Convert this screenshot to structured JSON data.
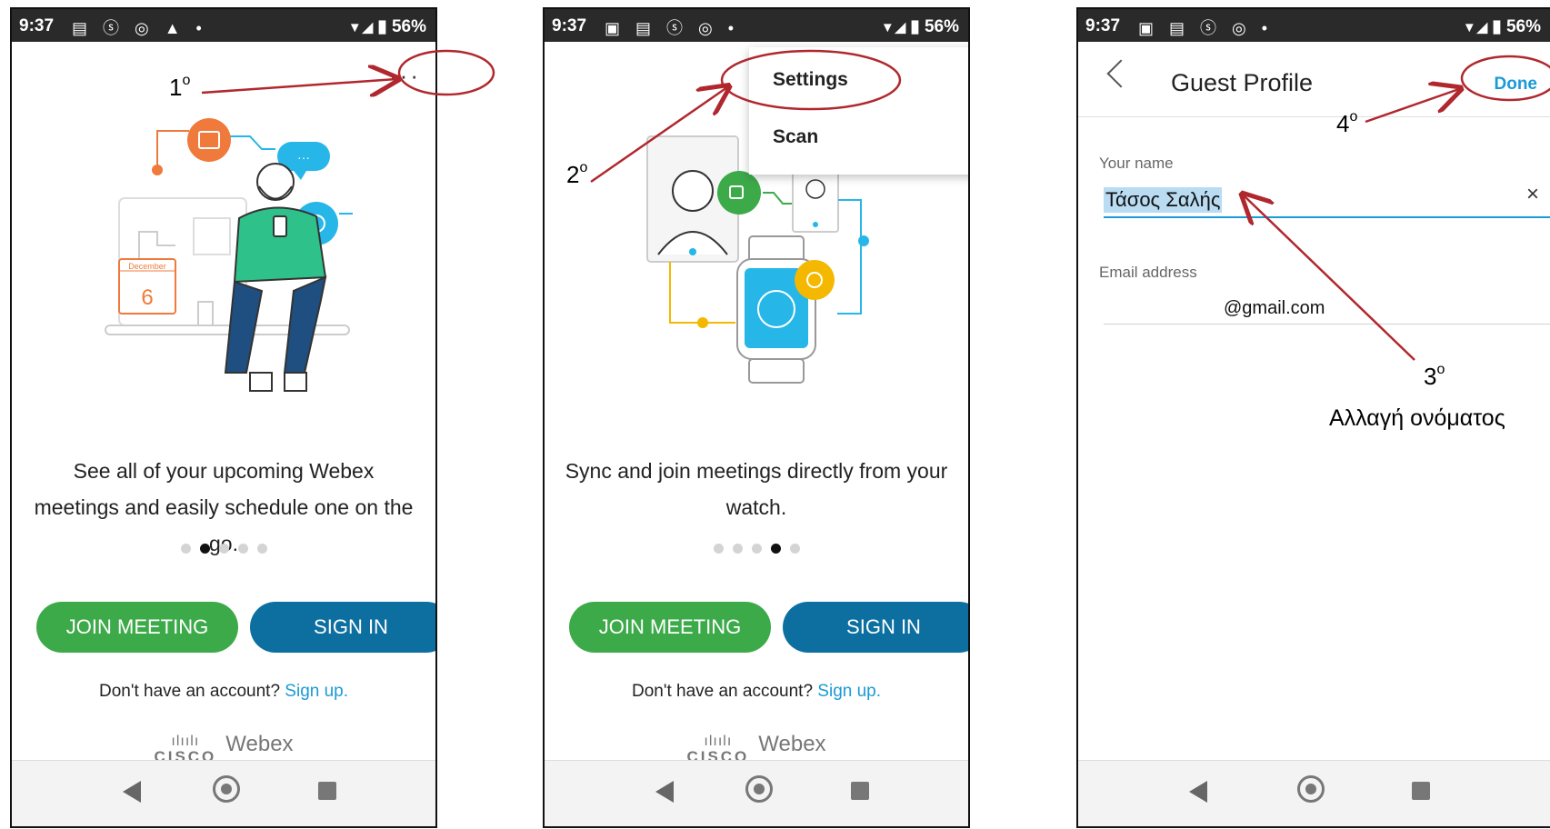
{
  "status": {
    "time": "9:37",
    "battery": "56%"
  },
  "screen1": {
    "caption": "See all of your upcoming Webex meetings and easily schedule one on the go.",
    "calendar_month": "December",
    "calendar_day": "6",
    "bubble_text": "···",
    "join_button": "JOIN MEETING",
    "signin_button": "SIGN IN",
    "signup_prefix": "Don't have an account?",
    "signup_link": "Sign up.",
    "brand_cisco": "CISCO",
    "brand_webex": "Webex",
    "overflow_label": "···",
    "active_dot": 1,
    "dot_count": 5
  },
  "screen2": {
    "menu_settings": "Settings",
    "menu_scan": "Scan",
    "caption": "Sync and join meetings directly from your watch.",
    "join_button": "JOIN MEETING",
    "signin_button": "SIGN IN",
    "signup_prefix": "Don't have an account?",
    "signup_link": "Sign up.",
    "brand_cisco": "CISCO",
    "brand_webex": "Webex",
    "active_dot": 3,
    "dot_count": 5
  },
  "screen3": {
    "title": "Guest Profile",
    "done": "Done",
    "name_label": "Your name",
    "name_value": "Τάσος Σαλής",
    "clear_icon": "×",
    "email_label": "Email address",
    "email_value": "@gmail.com"
  },
  "annotations": {
    "step1": "1",
    "step2": "2",
    "step3": "3",
    "step4": "4",
    "superscript": "o",
    "step3_note": "Αλλαγή ονόματος"
  },
  "colors": {
    "join_green": "#3daa4a",
    "signin_blue": "#0c6fa0",
    "link_blue": "#1a9ad6",
    "annotation_red": "#b0282e"
  }
}
